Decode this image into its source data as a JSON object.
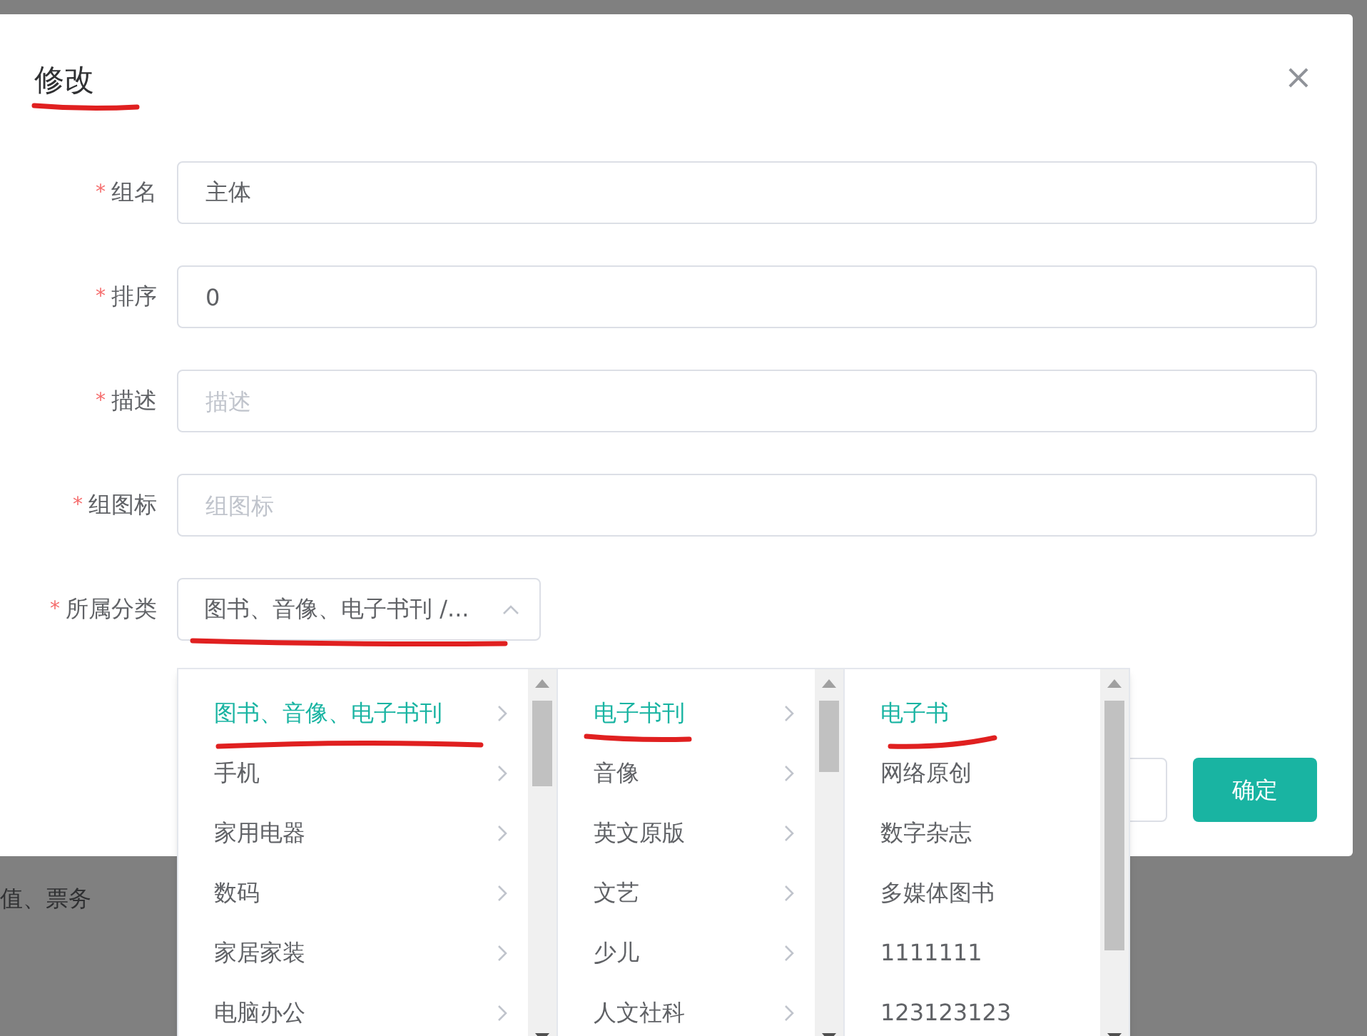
{
  "dialog": {
    "title": "修改",
    "close": "×"
  },
  "fields": [
    {
      "label": "组名",
      "required_mark": "*",
      "value": "主体"
    },
    {
      "label": "排序",
      "required_mark": "*",
      "value": "0"
    },
    {
      "label": "描述",
      "required_mark": "*",
      "placeholder": "描述"
    },
    {
      "label": "组图标",
      "required_mark": "*",
      "placeholder": "组图标"
    }
  ],
  "category": {
    "label": "所属分类",
    "required_mark": "*",
    "value": "图书、音像、电子书刊 /...",
    "expanded": true
  },
  "cascader_columns": [
    {
      "items": [
        {
          "label": "图书、音像、电子书刊",
          "selected": true,
          "has_children": true
        },
        {
          "label": "手机",
          "selected": false,
          "has_children": true
        },
        {
          "label": "家用电器",
          "selected": false,
          "has_children": true
        },
        {
          "label": "数码",
          "selected": false,
          "has_children": true
        },
        {
          "label": "家居家装",
          "selected": false,
          "has_children": true
        },
        {
          "label": "电脑办公",
          "selected": false,
          "has_children": true
        }
      ]
    },
    {
      "items": [
        {
          "label": "电子书刊",
          "selected": true,
          "has_children": true
        },
        {
          "label": "音像",
          "selected": false,
          "has_children": true
        },
        {
          "label": "英文原版",
          "selected": false,
          "has_children": true
        },
        {
          "label": "文艺",
          "selected": false,
          "has_children": true
        },
        {
          "label": "少儿",
          "selected": false,
          "has_children": true
        },
        {
          "label": "人文社科",
          "selected": false,
          "has_children": true
        }
      ]
    },
    {
      "items": [
        {
          "label": "电子书",
          "selected": true,
          "has_children": false
        },
        {
          "label": "网络原创",
          "selected": false,
          "has_children": false
        },
        {
          "label": "数字杂志",
          "selected": false,
          "has_children": false
        },
        {
          "label": "多媒体图书",
          "selected": false,
          "has_children": false
        },
        {
          "label": "1111111",
          "selected": false,
          "has_children": false
        },
        {
          "label": "123123123",
          "selected": false,
          "has_children": false
        }
      ]
    }
  ],
  "footer": {
    "confirm": "确定"
  },
  "background": {
    "text": "值、票务"
  }
}
